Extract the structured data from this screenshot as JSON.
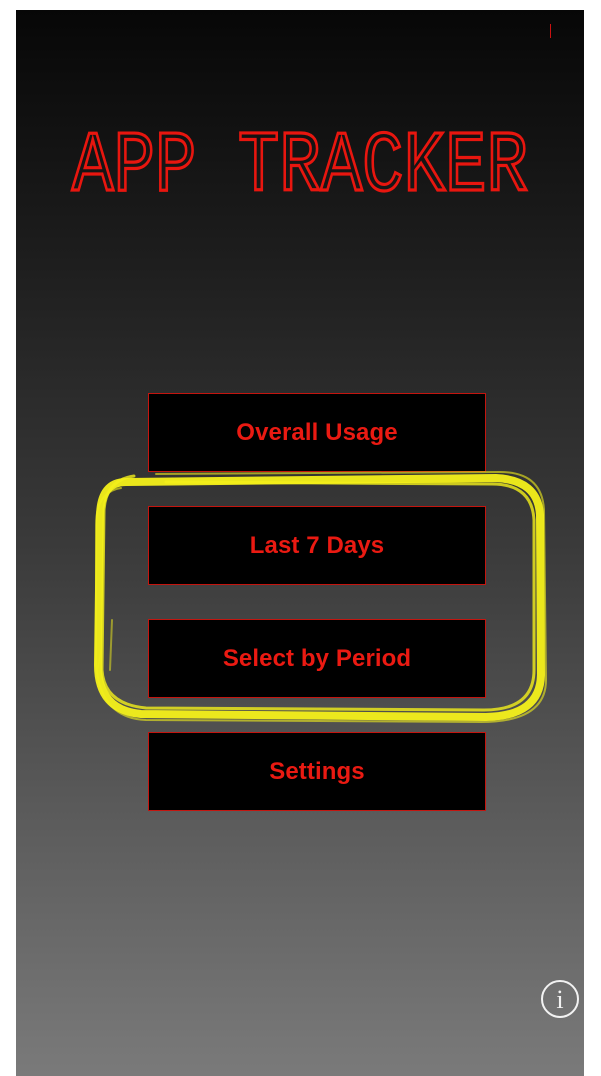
{
  "app": {
    "title": "APP TRACKER"
  },
  "menu": {
    "items": [
      {
        "id": "overall",
        "label": "Overall Usage"
      },
      {
        "id": "last7",
        "label": "Last 7 Days"
      },
      {
        "id": "period",
        "label": "Select by Period"
      },
      {
        "id": "settings",
        "label": "Settings"
      }
    ]
  },
  "info_button": {
    "icon": "info-icon"
  },
  "colors": {
    "accent_red": "#ea1a12",
    "button_border": "#c4150f",
    "button_bg": "#000000",
    "highlight_yellow": "#f4f01a"
  }
}
